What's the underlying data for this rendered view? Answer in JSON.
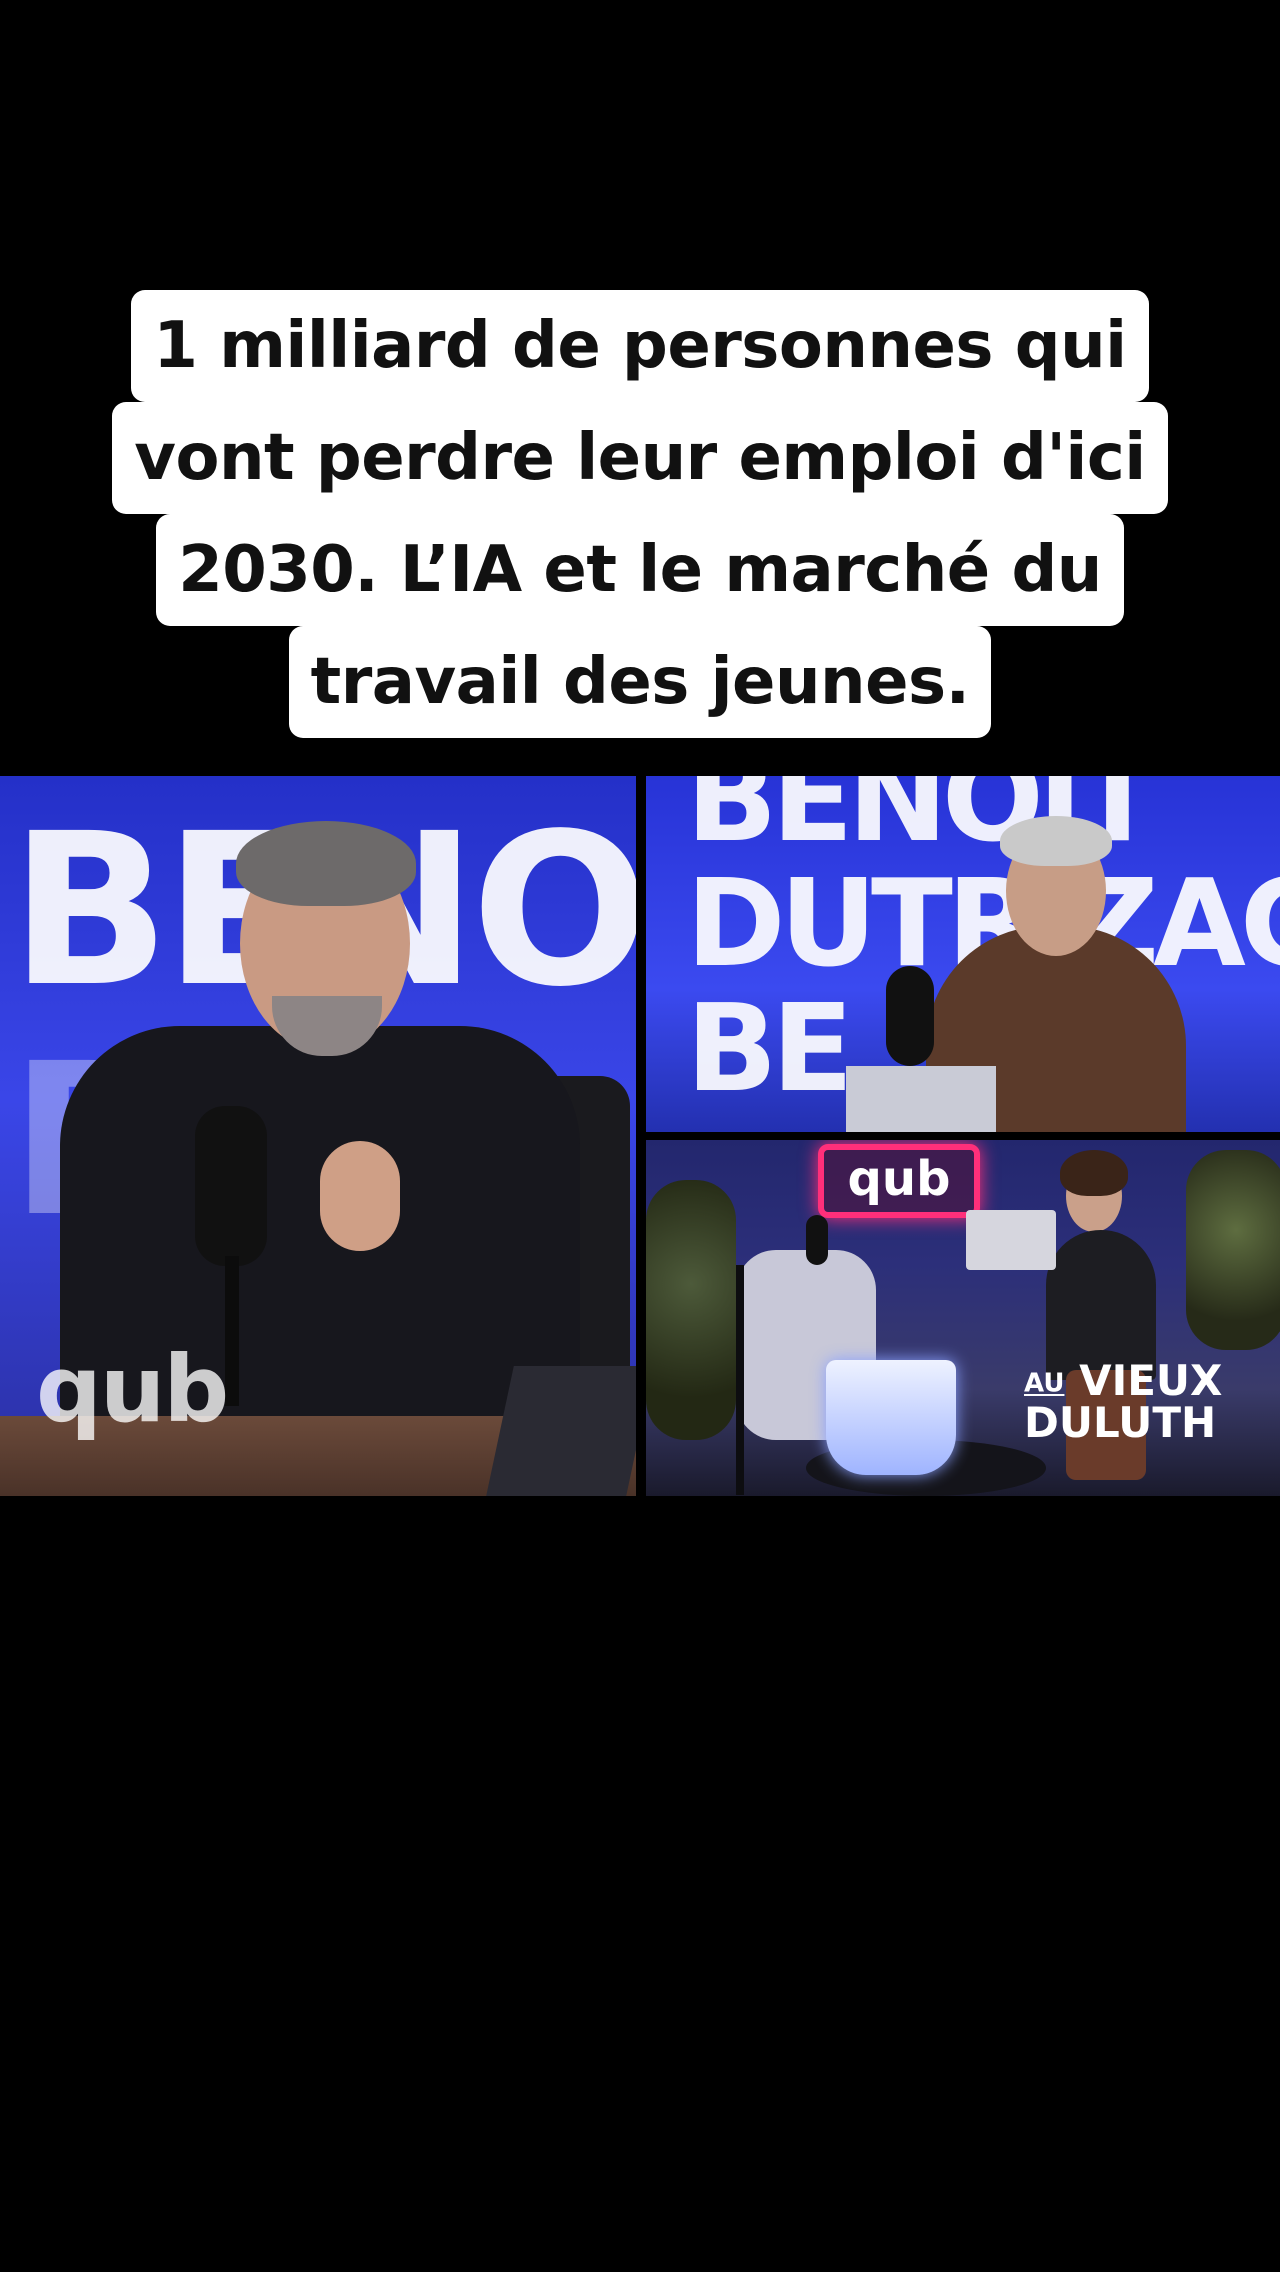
{
  "caption": {
    "lines": [
      "1 milliard de personnes qui",
      "vont perdre leur emploi d'ici",
      "2030. L’IA et le marché du",
      "travail des jeunes."
    ]
  },
  "video": {
    "left_panel": {
      "background_text": "BENOI",
      "watermark": "qub"
    },
    "top_right_panel": {
      "background_line1": "BENOIT",
      "background_line2": "DUTRIZAC",
      "background_line3": "BE"
    },
    "bottom_right_panel": {
      "neon_sign": "qub",
      "sponsor_prefix": "AU",
      "sponsor_line1": "VIEUX",
      "sponsor_line2": "DULUTH"
    }
  },
  "colors": {
    "studio_blue": "#3a46e8",
    "neon_pink": "#ff2f7a",
    "caption_bg": "#ffffff"
  }
}
